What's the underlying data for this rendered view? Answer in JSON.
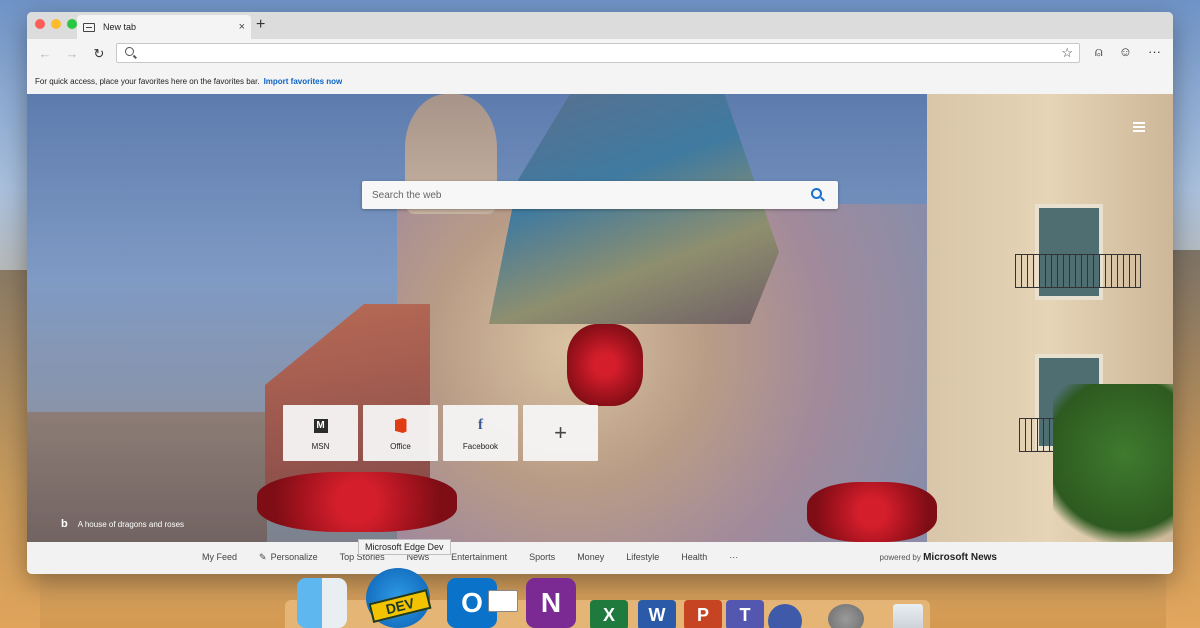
{
  "window": {
    "tab": {
      "title": "New tab",
      "close": "×"
    },
    "new_tab": "+"
  },
  "toolbar": {
    "back": "←",
    "forward": "→",
    "refresh": "↻",
    "star": "☆",
    "profile": "⍝",
    "emoji": "☺",
    "more": "···"
  },
  "favorites_bar": {
    "message": "For quick access, place your favorites here on the favorites bar.",
    "import_link": "Import favorites now"
  },
  "newtab_page": {
    "search_placeholder": "Search the web",
    "image_caption": "A house of dragons and roses",
    "bing_logo": "b",
    "tiles": [
      {
        "label": "MSN",
        "glyph": "M"
      },
      {
        "label": "Office",
        "glyph": ""
      },
      {
        "label": "Facebook",
        "glyph": "f"
      },
      {
        "label": "",
        "glyph": "+"
      }
    ]
  },
  "news_bar": {
    "items": [
      "My Feed",
      "Personalize",
      "Top Stories",
      "News",
      "Entertainment",
      "Sports",
      "Money",
      "Lifestyle",
      "Health",
      "···"
    ],
    "powered_prefix": "powered by",
    "powered_brand": "Microsoft News"
  },
  "tooltip": "Microsoft Edge Dev",
  "dock": {
    "dev_label": "DEV",
    "outlook": "O",
    "onenote": "N",
    "excel": "X",
    "word": "W",
    "powerpoint": "P",
    "teams": "T"
  },
  "colors": {
    "link": "#0b63c4",
    "search_accent": "#1a6fd0"
  }
}
